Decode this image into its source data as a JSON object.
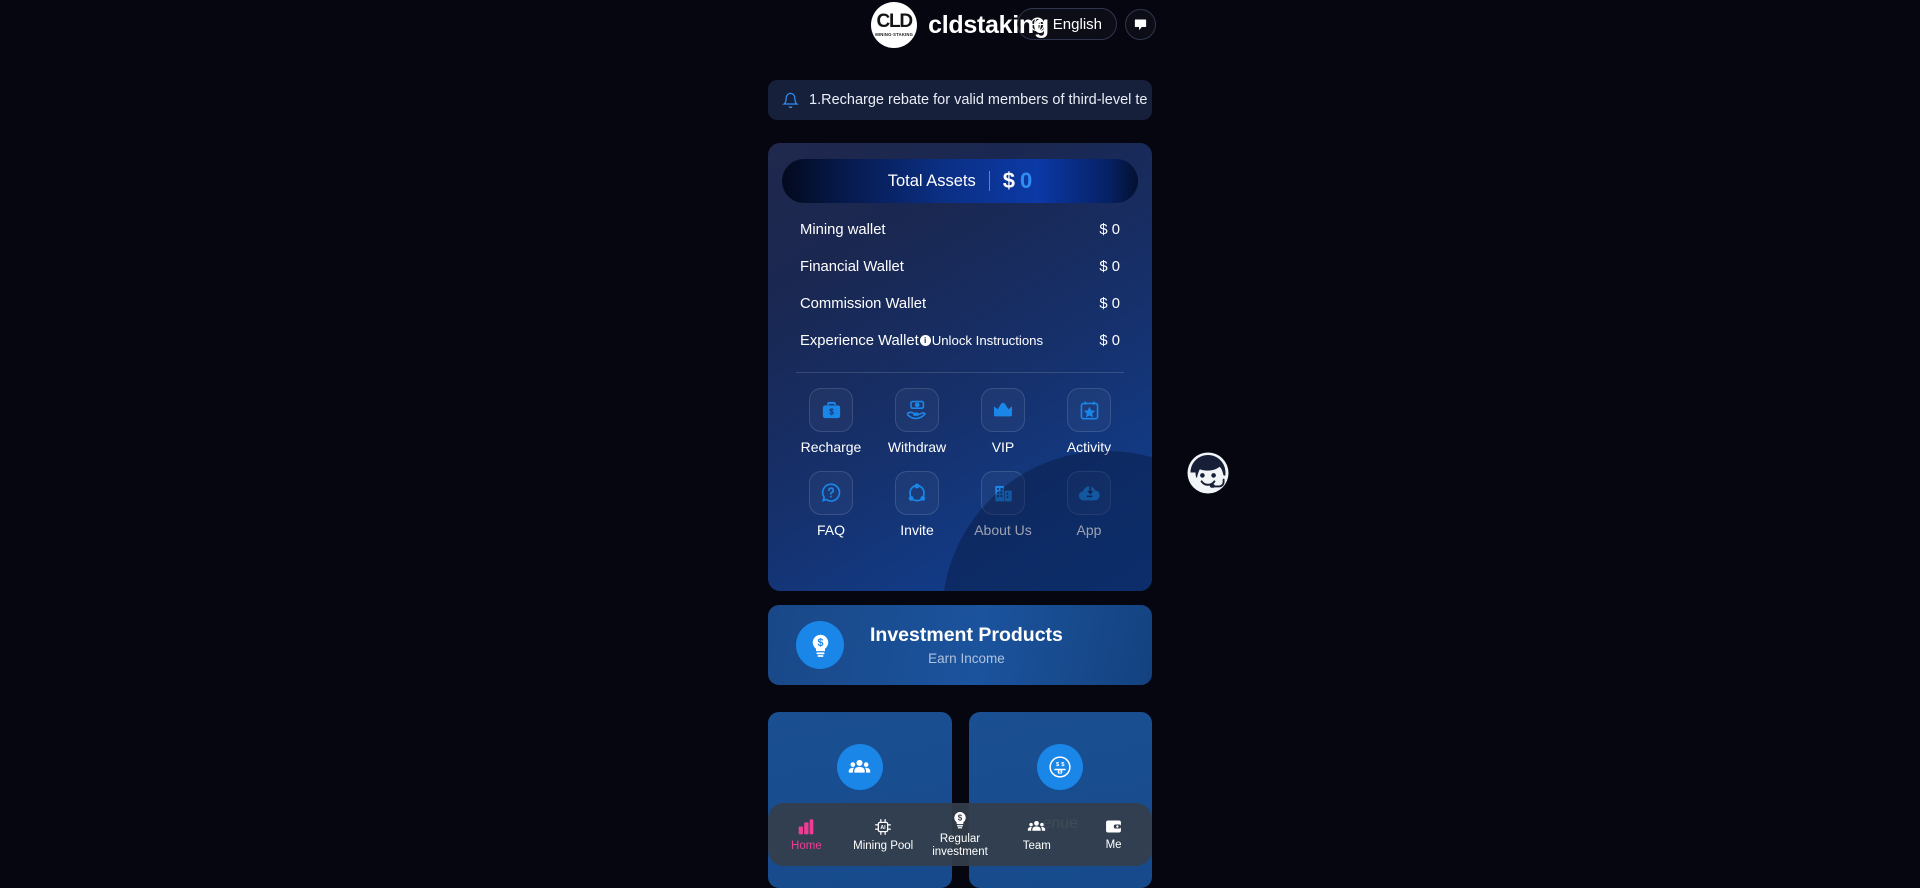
{
  "header": {
    "brand_logo_text": "CLD",
    "brand_logo_sub": "MINING·STAKING",
    "brand_name": "cldstaking",
    "language_label": "English",
    "language_icon": "globe-icon",
    "chat_icon": "chat-bubble-icon"
  },
  "notice": {
    "icon": "bell-icon",
    "text": "1.Recharge rebate for valid members of third-level te"
  },
  "assets": {
    "total_label": "Total Assets",
    "total_currency": "$",
    "total_value": "0",
    "wallets": [
      {
        "name": "Mining wallet",
        "value": "$ 0",
        "has_info": false,
        "info_text": ""
      },
      {
        "name": "Financial Wallet",
        "value": "$ 0",
        "has_info": false,
        "info_text": ""
      },
      {
        "name": "Commission Wallet",
        "value": "$ 0",
        "has_info": false,
        "info_text": ""
      },
      {
        "name": "Experience Wallet",
        "value": "$ 0",
        "has_info": true,
        "info_text": "Unlock Instructions"
      }
    ],
    "shortcuts": [
      {
        "label": "Recharge",
        "icon": "briefcase-dollar-icon"
      },
      {
        "label": "Withdraw",
        "icon": "hand-money-icon"
      },
      {
        "label": "VIP",
        "icon": "crown-icon"
      },
      {
        "label": "Activity",
        "icon": "calendar-star-icon"
      },
      {
        "label": "FAQ",
        "icon": "question-bubble-icon"
      },
      {
        "label": "Invite",
        "icon": "share-nodes-icon"
      },
      {
        "label": "About Us",
        "icon": "building-icon"
      },
      {
        "label": "App",
        "icon": "cloud-download-icon"
      }
    ]
  },
  "investment": {
    "icon": "lightbulb-dollar-icon",
    "title": "Investment Products",
    "subtitle": "Earn Income"
  },
  "lower_cards": [
    {
      "icon": "people-group-icon",
      "caption": ""
    },
    {
      "icon": "money-face-icon",
      "caption": "enue"
    }
  ],
  "customer_service": {
    "icon": "headset-avatar-icon"
  },
  "bottom_nav": {
    "items": [
      {
        "label": "Home",
        "icon": "home-chart-icon",
        "active": true
      },
      {
        "label": "Mining Pool",
        "icon": "ai-chip-icon",
        "active": false
      },
      {
        "label": "Regular investment",
        "icon": "lightbulb-dollar-icon",
        "active": false
      },
      {
        "label": "Team",
        "icon": "people-group-icon",
        "active": false
      },
      {
        "label": "Me",
        "icon": "wallet-icon",
        "active": false
      }
    ]
  },
  "colors": {
    "accent_blue": "#1a86e8",
    "accent_pink": "#ef3d96",
    "value_blue": "#2f8df4",
    "panel_navy": "#16306b",
    "nav_bar": "#343e4b"
  }
}
